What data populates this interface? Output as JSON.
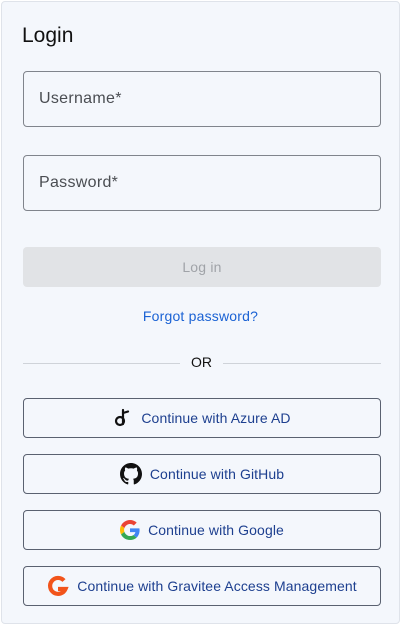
{
  "login": {
    "title": "Login",
    "username": {
      "placeholder": "Username*",
      "value": ""
    },
    "password": {
      "placeholder": "Password*",
      "value": ""
    },
    "login_button": "Log in",
    "forgot_password": "Forgot password?",
    "divider_text": "OR",
    "providers": [
      {
        "label": "Continue with Azure AD",
        "icon": "azure-ad-icon"
      },
      {
        "label": "Continue with GitHub",
        "icon": "github-icon"
      },
      {
        "label": "Continue with Google",
        "icon": "google-icon"
      },
      {
        "label": "Continue with Gravitee Access Management",
        "icon": "gravitee-icon"
      }
    ]
  },
  "colors": {
    "card_background": "#f4f7fc",
    "link": "#1a62d4",
    "provider_text": "#1d3f8f",
    "disabled_button": "#e1e3e6",
    "gravitee_brand": "#f2541b"
  }
}
